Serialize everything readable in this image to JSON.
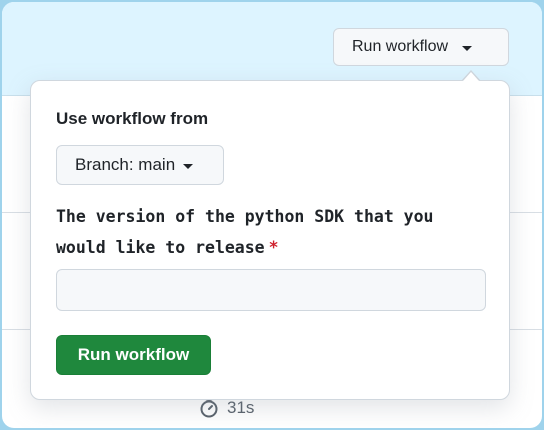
{
  "header": {
    "run_workflow_label": "Run workflow"
  },
  "popover": {
    "use_workflow_from_label": "Use workflow from",
    "branch_label": "Branch: main",
    "input_label": "The version of the python SDK that you would like to release",
    "required_marker": "*",
    "input_value": "",
    "submit_label": "Run workflow"
  },
  "background_row": {
    "duration": "31s",
    "duration_icon": "stopwatch-icon"
  },
  "colors": {
    "banner": "#ddf4ff",
    "primary_button": "#1f883d",
    "required": "#cf222e"
  }
}
